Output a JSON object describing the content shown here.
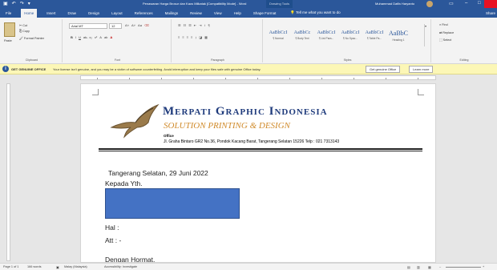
{
  "window": {
    "title": "Penawaran Harga Brosur dan Kaos Milkatak [Compatibility Mode] - Word",
    "contextual_tab": "Drawing Tools",
    "user": "Muhammad Daffa Haryanto"
  },
  "tabs": [
    "File",
    "Home",
    "Insert",
    "Draw",
    "Design",
    "Layout",
    "References",
    "Mailings",
    "Review",
    "View",
    "Help",
    "Shape Format"
  ],
  "tell_me": "Tell me what you want to do",
  "share": "Share",
  "ribbon": {
    "clipboard": {
      "label": "Clipboard",
      "paste": "Paste",
      "cut": "Cut",
      "copy": "Copy",
      "format_painter": "Format Painter"
    },
    "font": {
      "label": "Font",
      "font_name": "Arial MT",
      "font_size": "12"
    },
    "paragraph": {
      "label": "Paragraph"
    },
    "styles": {
      "label": "Styles",
      "items": [
        {
          "sample": "AaBbCcI",
          "name": "¶ Normal"
        },
        {
          "sample": "AaBbCc",
          "name": "¶ Body Text"
        },
        {
          "sample": "AaBbCcI",
          "name": "¶ List Para..."
        },
        {
          "sample": "AaBbCcI",
          "name": "¶ No Spac..."
        },
        {
          "sample": "AaBbCcI",
          "name": "¶ Table Pa..."
        },
        {
          "sample": "AaBbC",
          "name": "Heading 1"
        }
      ]
    },
    "editing": {
      "label": "Editing",
      "find": "Find",
      "replace": "Replace",
      "select": "Select"
    }
  },
  "message_bar": {
    "label": "GET GENUINE OFFICE",
    "text": "Your license isn't genuine, and you may be a victim of software counterfeiting. Avoid interruption and keep your files safe with genuine Office today.",
    "primary_button": "Get genuine Office",
    "secondary_button": "Learn more"
  },
  "document": {
    "brand": "Merpati Graphic Indonesia",
    "tagline": "SOLUTION PRINTING & DESIGN",
    "office_label": "Office",
    "address": "Jl. Graha Bintaro GR2 No.36, Pondok Kacang Barat, Tangerang Selatan 15226 Telp : 021 7313143",
    "date_line": "Tangerang Selatan, 29 Juni 2022",
    "to_line": "Kepada Yth.",
    "hal_line": "Hal :",
    "att_line": "Att   : -",
    "greeting": "Dengan Hormat,"
  },
  "status_bar": {
    "page": "Page 1 of 1",
    "words": "166 words",
    "language": "Malay (Malaysia)",
    "accessibility": "Accessibility: Investigate"
  },
  "colors": {
    "word_blue": "#2b579a",
    "brand_navy": "#1f3b7c",
    "tagline_orange": "#d08a2a",
    "highlight_box": "#4472c4",
    "message_bar_bg": "#fcf7b6"
  }
}
